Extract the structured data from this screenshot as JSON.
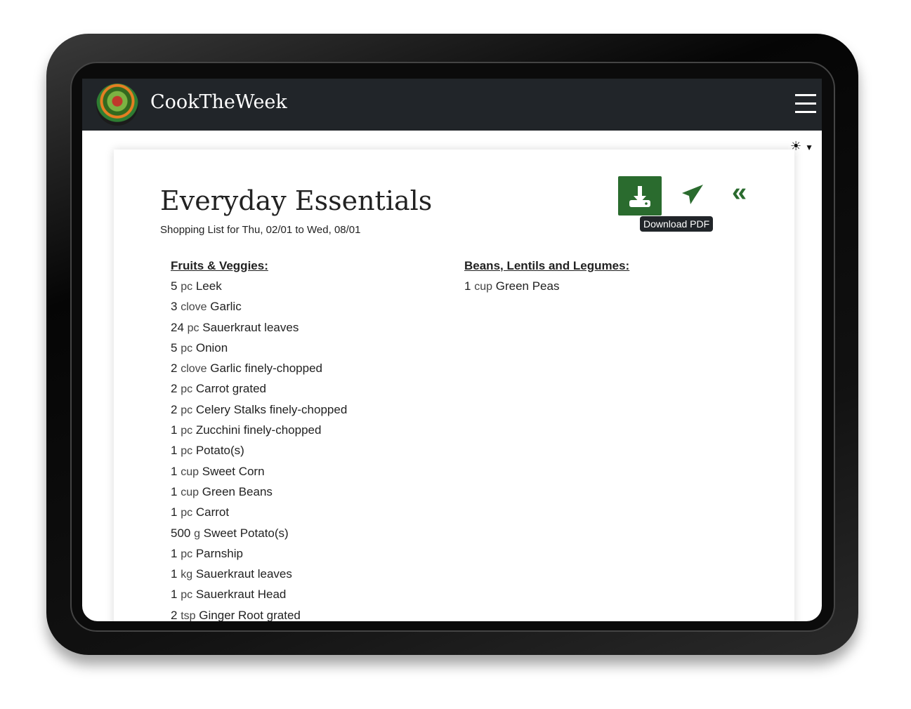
{
  "app": {
    "brand": "CookTheWeek",
    "logo_text": "Cook the Week"
  },
  "page": {
    "title": "Everyday Essentials",
    "subtitle": "Shopping List for Thu, 02/01 to Wed, 08/01"
  },
  "actions": {
    "download_tooltip": "Download PDF"
  },
  "categories": [
    {
      "title": "Fruits & Veggies:",
      "items": [
        {
          "qty": "5",
          "unit": "pc",
          "name": "Leek"
        },
        {
          "qty": "3",
          "unit": "clove",
          "name": "Garlic"
        },
        {
          "qty": "24",
          "unit": "pc",
          "name": "Sauerkraut leaves"
        },
        {
          "qty": "5",
          "unit": "pc",
          "name": "Onion"
        },
        {
          "qty": "2",
          "unit": "clove",
          "name": "Garlic finely-chopped"
        },
        {
          "qty": "2",
          "unit": "pc",
          "name": "Carrot grated"
        },
        {
          "qty": "2",
          "unit": "pc",
          "name": "Celery Stalks finely-chopped"
        },
        {
          "qty": "1",
          "unit": "pc",
          "name": "Zucchini finely-chopped"
        },
        {
          "qty": "1",
          "unit": "pc",
          "name": "Potato(s)"
        },
        {
          "qty": "1",
          "unit": "cup",
          "name": "Sweet Corn"
        },
        {
          "qty": "1",
          "unit": "cup",
          "name": "Green Beans"
        },
        {
          "qty": "1",
          "unit": "pc",
          "name": "Carrot"
        },
        {
          "qty": "500",
          "unit": "g",
          "name": "Sweet Potato(s)"
        },
        {
          "qty": "1",
          "unit": "pc",
          "name": "Parnship"
        },
        {
          "qty": "1",
          "unit": "kg",
          "name": "Sauerkraut leaves"
        },
        {
          "qty": "1",
          "unit": "pc",
          "name": "Sauerkraut Head"
        },
        {
          "qty": "2",
          "unit": "tsp",
          "name": "Ginger Root grated"
        }
      ]
    },
    {
      "title": "Beans, Lentils and Legumes:",
      "items": [
        {
          "qty": "1",
          "unit": "cup",
          "name": "Green Peas"
        }
      ]
    }
  ],
  "colors": {
    "accent": "#2a6b2e",
    "navbar": "#212529"
  }
}
